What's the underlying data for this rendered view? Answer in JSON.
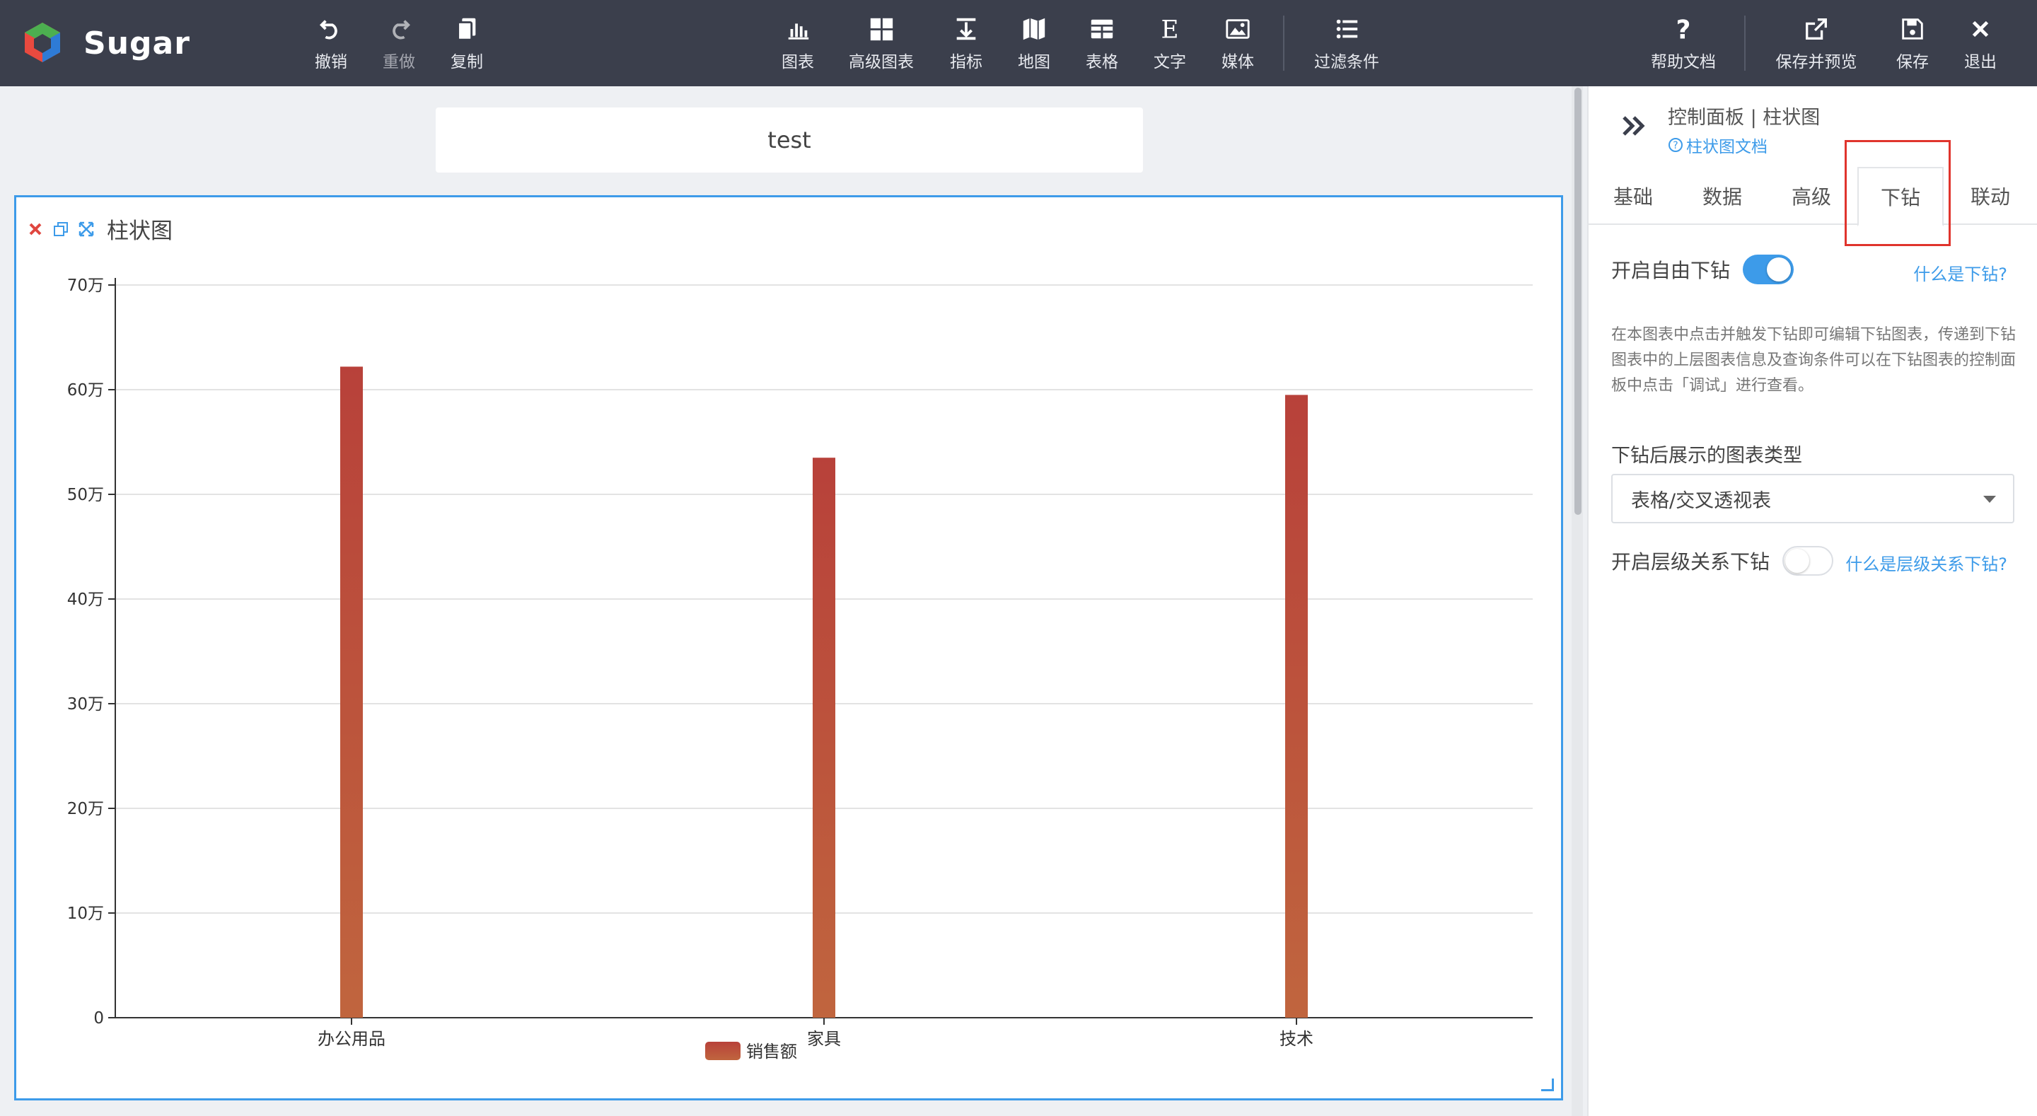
{
  "app": {
    "name": "Sugar"
  },
  "toolbar": {
    "left": [
      {
        "label": "撤销",
        "icon": "undo-icon"
      },
      {
        "label": "重做",
        "icon": "redo-icon"
      },
      {
        "label": "复制",
        "icon": "copy-icon"
      }
    ],
    "center": [
      {
        "label": "图表",
        "icon": "chart-icon"
      },
      {
        "label": "高级图表",
        "icon": "advanced-chart-icon"
      },
      {
        "label": "指标",
        "icon": "indicator-icon"
      },
      {
        "label": "地图",
        "icon": "map-icon"
      },
      {
        "label": "表格",
        "icon": "table-icon"
      },
      {
        "label": "文字",
        "icon": "text-icon"
      },
      {
        "label": "媒体",
        "icon": "media-icon"
      },
      {
        "label": "过滤条件",
        "icon": "filter-list-icon"
      }
    ],
    "right": [
      {
        "label": "帮助文档",
        "icon": "help-icon"
      },
      {
        "label": "保存并预览",
        "icon": "external-link-icon"
      },
      {
        "label": "保存",
        "icon": "save-icon"
      },
      {
        "label": "退出",
        "icon": "close-icon"
      }
    ]
  },
  "canvas": {
    "title": "test",
    "chart_panel_title": "柱状图"
  },
  "chart_data": {
    "type": "bar",
    "categories": [
      "办公用品",
      "家具",
      "技术"
    ],
    "series": [
      {
        "name": "销售额",
        "values": [
          622000,
          535000,
          595000
        ]
      }
    ],
    "yticks": [
      "0",
      "10万",
      "20万",
      "30万",
      "40万",
      "50万",
      "60万",
      "70万"
    ],
    "ylim": [
      0,
      700000
    ],
    "grid": true,
    "legend": "bottom-center",
    "bar_color_top": "#b8413a",
    "bar_color_bottom": "#c0653e"
  },
  "control_panel": {
    "title": "控制面板 | 柱状图",
    "doc_link": "柱状图文档",
    "tabs": [
      "基础",
      "数据",
      "高级",
      "下钻",
      "联动"
    ],
    "active_tab": "下钻",
    "free_drill": {
      "label": "开启自由下钻",
      "enabled": true,
      "help": "什么是下钻?"
    },
    "description": "在本图表中点击并触发下钻即可编辑下钻图表，传递到下钻图表中的上层图表信息及查询条件可以在下钻图表的控制面板中点击「调试」进行查看。",
    "drill_chart_type": {
      "label": "下钻后展示的图表类型",
      "value": "表格/交叉透视表"
    },
    "hier_drill": {
      "label": "开启层级关系下钻",
      "enabled": false,
      "help": "什么是层级关系下钻?"
    }
  },
  "colors": {
    "accent": "#3d9be9",
    "topbar": "#3b3f4c",
    "highlight": "#e0342d"
  }
}
